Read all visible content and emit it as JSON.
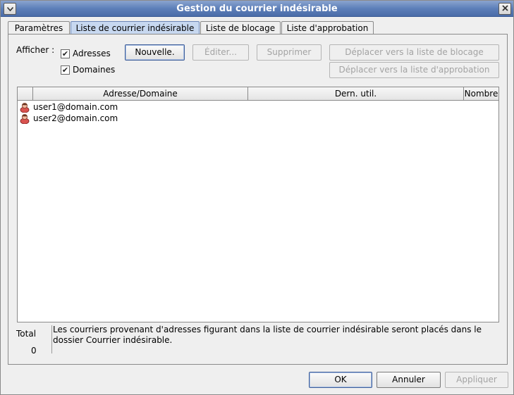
{
  "window": {
    "title": "Gestion du courrier indésirable",
    "menu_icon": "chevron-down-icon",
    "close_icon": "close-icon"
  },
  "tabs": [
    {
      "label": "Paramètres",
      "active": false
    },
    {
      "label": "Liste de courrier indésirable",
      "active": true
    },
    {
      "label": "Liste de blocage",
      "active": false
    },
    {
      "label": "Liste d'approbation",
      "active": false
    }
  ],
  "filters": {
    "label": "Afficher :",
    "addresses": {
      "label": "Adresses",
      "checked": true
    },
    "domains": {
      "label": "Domaines",
      "checked": true
    }
  },
  "actions": {
    "new": "Nouvelle.",
    "edit": "Éditer...",
    "delete": "Supprimer",
    "move_block": "Déplacer vers la liste de blocage",
    "move_approve": "Déplacer vers la liste d'approbation"
  },
  "table": {
    "columns": [
      "Adresse/Domaine",
      "Dern. util.",
      "Nombre"
    ],
    "rows": [
      {
        "address": "user1@domain.com",
        "last_used": "",
        "count": "",
        "icon": "person-icon"
      },
      {
        "address": "user2@domain.com",
        "last_used": "",
        "count": "",
        "icon": "person-icon"
      }
    ]
  },
  "footer": {
    "total_label": "Total",
    "total_value": "0",
    "info_line1": "Les courriers provenant d'adresses figurant dans la liste de courrier indésirable seront placés dans le",
    "info_line2": "dossier Courrier indésirable."
  },
  "dialog_buttons": {
    "ok": "OK",
    "cancel": "Annuler",
    "apply": "Appliquer"
  },
  "colors": {
    "titlebar": "#5d7fb9",
    "active_tab": "#c7d8f0",
    "disabled_text": "#a3a3a3"
  }
}
